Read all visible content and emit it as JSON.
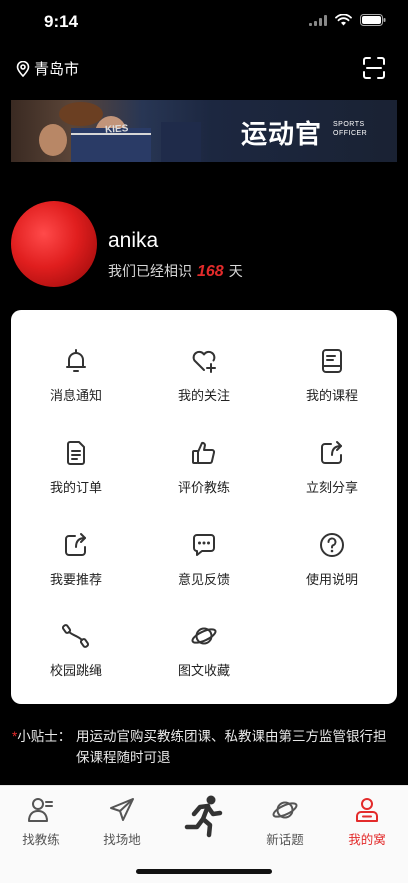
{
  "status_bar": {
    "time": "9:14"
  },
  "header": {
    "city": "青岛市"
  },
  "banner": {
    "brand": "运动官",
    "brand_sub": "SPORTS OFFICER",
    "jersey_text": "KIES"
  },
  "profile": {
    "username": "anika",
    "days_prefix": "我们已经相识",
    "days_count": "168",
    "days_suffix": "天"
  },
  "menu": [
    {
      "label": "消息通知",
      "icon": "bell-icon"
    },
    {
      "label": "我的关注",
      "icon": "heart-plus-icon"
    },
    {
      "label": "我的课程",
      "icon": "book-icon"
    },
    {
      "label": "我的订单",
      "icon": "document-icon"
    },
    {
      "label": "评价教练",
      "icon": "thumbs-up-icon"
    },
    {
      "label": "立刻分享",
      "icon": "share-icon"
    },
    {
      "label": "我要推荐",
      "icon": "recommend-share-icon"
    },
    {
      "label": "意见反馈",
      "icon": "chat-bubble-icon"
    },
    {
      "label": "使用说明",
      "icon": "question-circle-icon"
    },
    {
      "label": "校园跳绳",
      "icon": "jump-rope-icon"
    },
    {
      "label": "图文收藏",
      "icon": "planet-icon"
    }
  ],
  "tip": {
    "label": "小贴士：",
    "text": "用运动官购买教练团课、私教课由第三方监管银行担保课程随时可退"
  },
  "tabs": [
    {
      "label": "找教练",
      "icon": "coach-icon"
    },
    {
      "label": "找场地",
      "icon": "paper-plane-icon"
    },
    {
      "label": "",
      "icon": "runner-icon"
    },
    {
      "label": "新话题",
      "icon": "planet-icon"
    },
    {
      "label": "我的窝",
      "icon": "user-icon",
      "active": true
    }
  ],
  "colors": {
    "accent": "#e32b2b",
    "background": "#000000",
    "card": "#ffffff"
  }
}
